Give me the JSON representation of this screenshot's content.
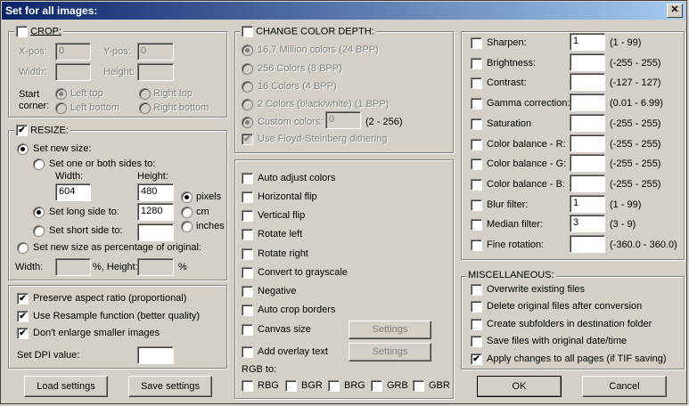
{
  "window": {
    "title": "Set for all images:",
    "close": "✕"
  },
  "crop": {
    "label": "CROP:",
    "xpos_label": "X-pos:",
    "xpos": "0",
    "ypos_label": "Y-pos:",
    "ypos": "0",
    "width_label": "Width:",
    "height_label": "Height:",
    "start_label": "Start",
    "corner_label": "corner:",
    "left_top": "Left top",
    "right_top": "Right top",
    "left_bottom": "Left bottom",
    "right_bottom": "Right bottom"
  },
  "resize": {
    "label": "RESIZE:",
    "set_new_size": "Set new size:",
    "one_or_both": "Set one or both sides to:",
    "width_label": "Width:",
    "height_label": "Height:",
    "width_value": "604",
    "height_value": "480",
    "long_side": "Set long side to:",
    "long_value": "1280",
    "short_side": "Set short side to:",
    "short_value": "",
    "unit_pixels": "pixels",
    "unit_cm": "cm",
    "unit_inches": "inches",
    "percentage": "Set new size as percentage of original:",
    "pct_width": "Width:",
    "pct_pct1": "%, Height:",
    "pct_pct2": "%"
  },
  "options": {
    "preserve": "Preserve aspect ratio (proportional)",
    "resample": "Use Resample function (better quality)",
    "dont_enlarge": "Don't enlarge smaller images",
    "dpi_label": "Set DPI value:",
    "dpi_value": ""
  },
  "buttons": {
    "load": "Load settings",
    "save": "Save settings",
    "ok": "OK",
    "cancel": "Cancel",
    "settings": "Settings"
  },
  "color_depth": {
    "label": "CHANGE COLOR DEPTH:",
    "opt1": "16,7 Million colors (24 BPP)",
    "opt2": "256 Colors (8 BPP)",
    "opt3": "16 Colors (4 BPP)",
    "opt4": "2 Colors (black/white) (1 BPP)",
    "custom": "Custom colors:",
    "custom_value": "0",
    "custom_range": "(2 - 256)",
    "dither": "Use Floyd-Steinberg dithering"
  },
  "transforms": {
    "auto_adjust": "Auto adjust colors",
    "hflip": "Horizontal flip",
    "vflip": "Vertical flip",
    "rot_left": "Rotate left",
    "rot_right": "Rotate right",
    "grayscale": "Convert to grayscale",
    "negative": "Negative",
    "autocrop": "Auto crop borders",
    "canvas": "Canvas size",
    "overlay": "Add overlay text",
    "rgb_label": "RGB to:",
    "rgb": [
      "RBG",
      "BGR",
      "BRG",
      "GRB",
      "GBR"
    ]
  },
  "adjust": [
    {
      "label": "Sharpen:",
      "value": "1",
      "range": "(1  -  99)"
    },
    {
      "label": "Brightness:",
      "value": "",
      "range": "(-255  -  255)"
    },
    {
      "label": "Contrast:",
      "value": "",
      "range": "(-127  -  127)"
    },
    {
      "label": "Gamma correction:",
      "value": "",
      "range": "(0.01  -  6.99)"
    },
    {
      "label": "Saturation",
      "value": "",
      "range": "(-255  -  255)"
    },
    {
      "label": "Color balance - R:",
      "value": "",
      "range": "(-255  -  255)"
    },
    {
      "label": "Color balance - G:",
      "value": "",
      "range": "(-255  -  255)"
    },
    {
      "label": "Color balance - B:",
      "value": "",
      "range": "(-255  -  255)"
    },
    {
      "label": "Blur filter:",
      "value": "1",
      "range": "(1  -  99)"
    },
    {
      "label": "Median filter:",
      "value": "3",
      "range": "(3  -  9)"
    },
    {
      "label": "Fine rotation:",
      "value": "",
      "range": "(-360.0  -  360.0)"
    }
  ],
  "misc": {
    "label": "MISCELLANEOUS:",
    "overwrite": "Overwrite existing files",
    "delete": "Delete original files after conversion",
    "subfolders": "Create subfolders in destination folder",
    "keep_date": "Save files with original date/time",
    "all_pages": "Apply changes to all pages (if TIF saving)"
  },
  "check": "✔"
}
